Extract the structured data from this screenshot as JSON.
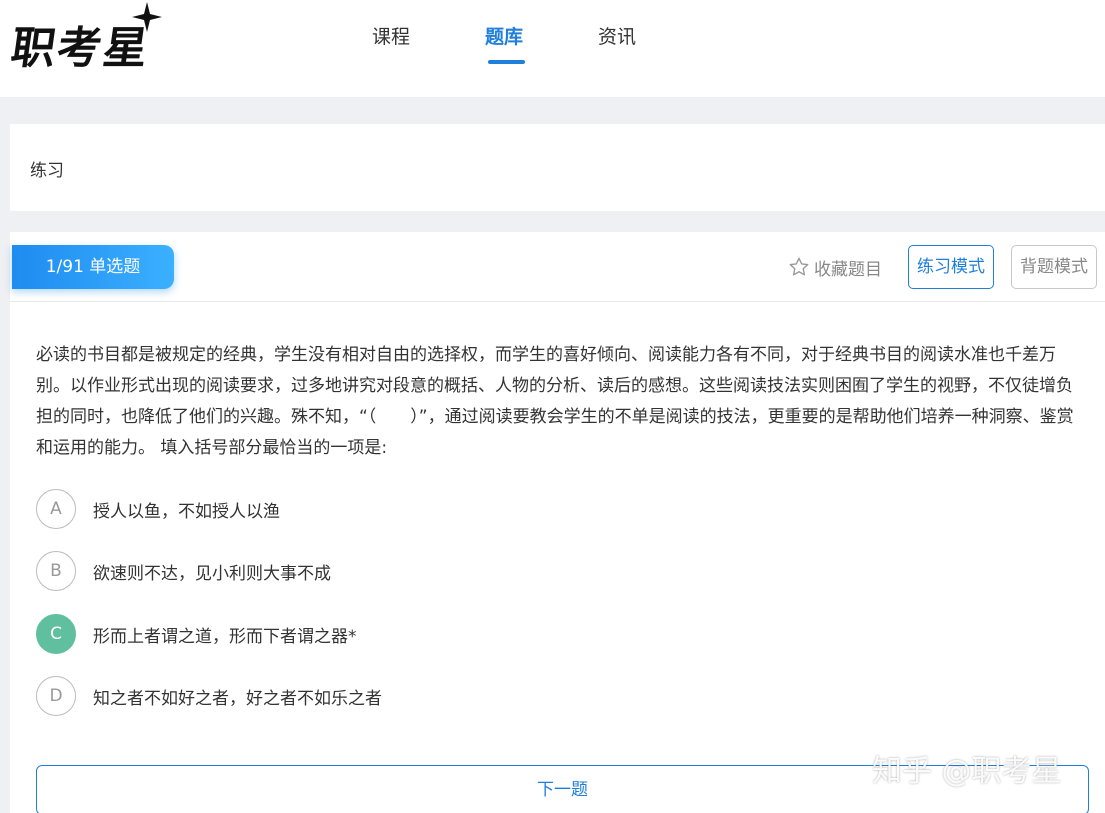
{
  "header": {
    "logo_text": "职考星",
    "nav": [
      {
        "label": "课程",
        "active": false
      },
      {
        "label": "题库",
        "active": true
      },
      {
        "label": "资讯",
        "active": false
      }
    ]
  },
  "breadcrumb": {
    "label": "练习"
  },
  "question_panel": {
    "type_badge": "1/91 单选题",
    "favorite_label": "收藏题目",
    "practice_mode_label": "练习模式",
    "recite_mode_label": "背题模式",
    "question_text": "必读的书目都是被规定的经典，学生没有相对自由的选择权，而学生的喜好倾向、阅读能力各有不同，对于经典书目的阅读水准也千差万别。以作业形式出现的阅读要求，过多地讲究对段意的概括、人物的分析、读后的感想。这些阅读技法实则困囿了学生的视野，不仅徒增负担的同时，也降低了他们的兴趣。殊不知，“（　　）”，通过阅读要教会学生的不单是阅读的技法，更重要的是帮助他们培养一种洞察、鉴赏和运用的能力。 填入括号部分最恰当的一项是:",
    "options": [
      {
        "letter": "A",
        "text": "授人以鱼，不如授人以渔",
        "selected": false
      },
      {
        "letter": "B",
        "text": "欲速则不达，见小利则大事不成",
        "selected": false
      },
      {
        "letter": "C",
        "text": "形而上者谓之道，形而下者谓之器*",
        "selected": true
      },
      {
        "letter": "D",
        "text": "知之者不如好之者，好之者不如乐之者",
        "selected": false
      }
    ],
    "next_label": "下一题"
  },
  "watermark": "知乎 @职考星",
  "colors": {
    "accent": "#1f7fdb",
    "selected_option": "#5fbf9f",
    "page_bg": "#eef0f3"
  }
}
